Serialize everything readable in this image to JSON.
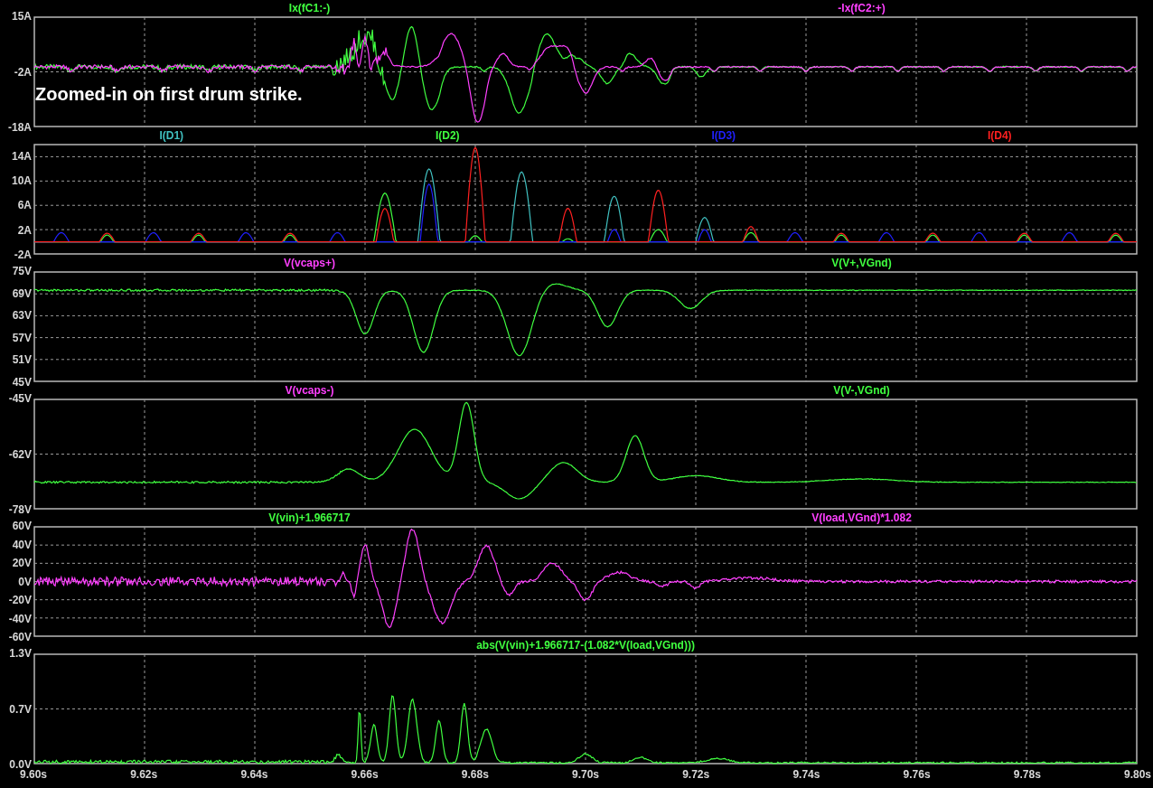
{
  "panes": [
    {
      "traces": [
        {
          "label": "Ix(fC1:-)",
          "color": "#40ff40"
        },
        {
          "label": "-Ix(fC2:+)",
          "color": "#ff40ff"
        }
      ],
      "y_ticks": [
        "15A",
        "-2A",
        "-18A"
      ],
      "annotation": "Zoomed-in on first drum strike."
    },
    {
      "traces": [
        {
          "label": "I(D1)",
          "color": "#40c0c0"
        },
        {
          "label": "I(D2)",
          "color": "#40ff40"
        },
        {
          "label": "I(D3)",
          "color": "#2020ff"
        },
        {
          "label": "I(D4)",
          "color": "#ff2020"
        }
      ],
      "y_ticks": [
        "14A",
        "10A",
        "6A",
        "2A",
        "-2A"
      ]
    },
    {
      "traces": [
        {
          "label": "V(vcaps+)",
          "color": "#ff40ff"
        },
        {
          "label": "V(V+,VGnd)",
          "color": "#40ff40"
        }
      ],
      "y_ticks": [
        "75V",
        "69V",
        "63V",
        "57V",
        "51V",
        "45V"
      ]
    },
    {
      "traces": [
        {
          "label": "V(vcaps-)",
          "color": "#ff40ff"
        },
        {
          "label": "V(V-,VGnd)",
          "color": "#40ff40"
        }
      ],
      "y_ticks": [
        "-45V",
        "-62V",
        "-78V"
      ]
    },
    {
      "traces": [
        {
          "label": "V(vin)+1.966717",
          "color": "#40ff40"
        },
        {
          "label": "V(load,VGnd)*1.082",
          "color": "#ff40ff"
        }
      ],
      "y_ticks": [
        "60V",
        "40V",
        "20V",
        "0V",
        "-20V",
        "-40V",
        "-60V"
      ]
    },
    {
      "traces": [
        {
          "label": "abs(V(vin)+1.966717-(1.082*V(load,VGnd)))",
          "color": "#40ff40"
        }
      ],
      "y_ticks": [
        "1.3V",
        "0.7V",
        "0.0V"
      ]
    }
  ],
  "x_ticks": [
    "9.60s",
    "9.62s",
    "9.64s",
    "9.66s",
    "9.68s",
    "9.70s",
    "9.72s",
    "9.74s",
    "9.76s",
    "9.78s",
    "9.80s"
  ]
}
